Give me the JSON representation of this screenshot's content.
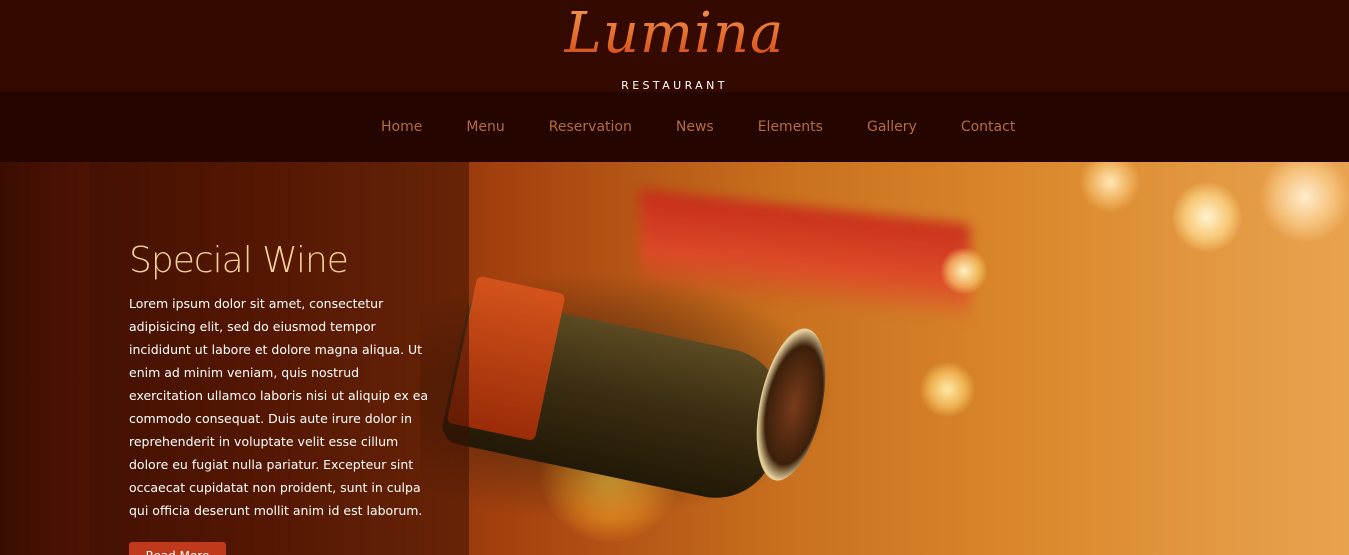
{
  "brand": {
    "name": "Lumina",
    "subtitle": "RESTAURANT"
  },
  "nav": {
    "items": [
      {
        "label": "Home"
      },
      {
        "label": "Menu"
      },
      {
        "label": "Reservation"
      },
      {
        "label": "News"
      },
      {
        "label": "Elements"
      },
      {
        "label": "Gallery"
      },
      {
        "label": "Contact"
      }
    ]
  },
  "hero": {
    "title": "Special Wine",
    "body": "Lorem ipsum dolor sit amet, consectetur adipisicing elit, sed do eiusmod tempor incididunt ut labore et dolore magna aliqua. Ut enim ad minim veniam, quis nostrud exercitation ullamco laboris nisi ut aliquip ex ea commodo consequat. Duis aute irure dolor in reprehenderit in voluptate velit esse cillum dolore eu fugiat nulla pariatur. Excepteur sint occaecat cupidatat non proident, sunt in culpa qui officia deserunt mollit anim id est laborum.",
    "button_label": "Read More",
    "image": "wine-bottle-photo"
  },
  "colors": {
    "header_bg": "#330900",
    "nav_bg": "#250500",
    "nav_text": "#b56c40",
    "title_text": "#f2cf97",
    "button_bg": "#c0391b"
  }
}
